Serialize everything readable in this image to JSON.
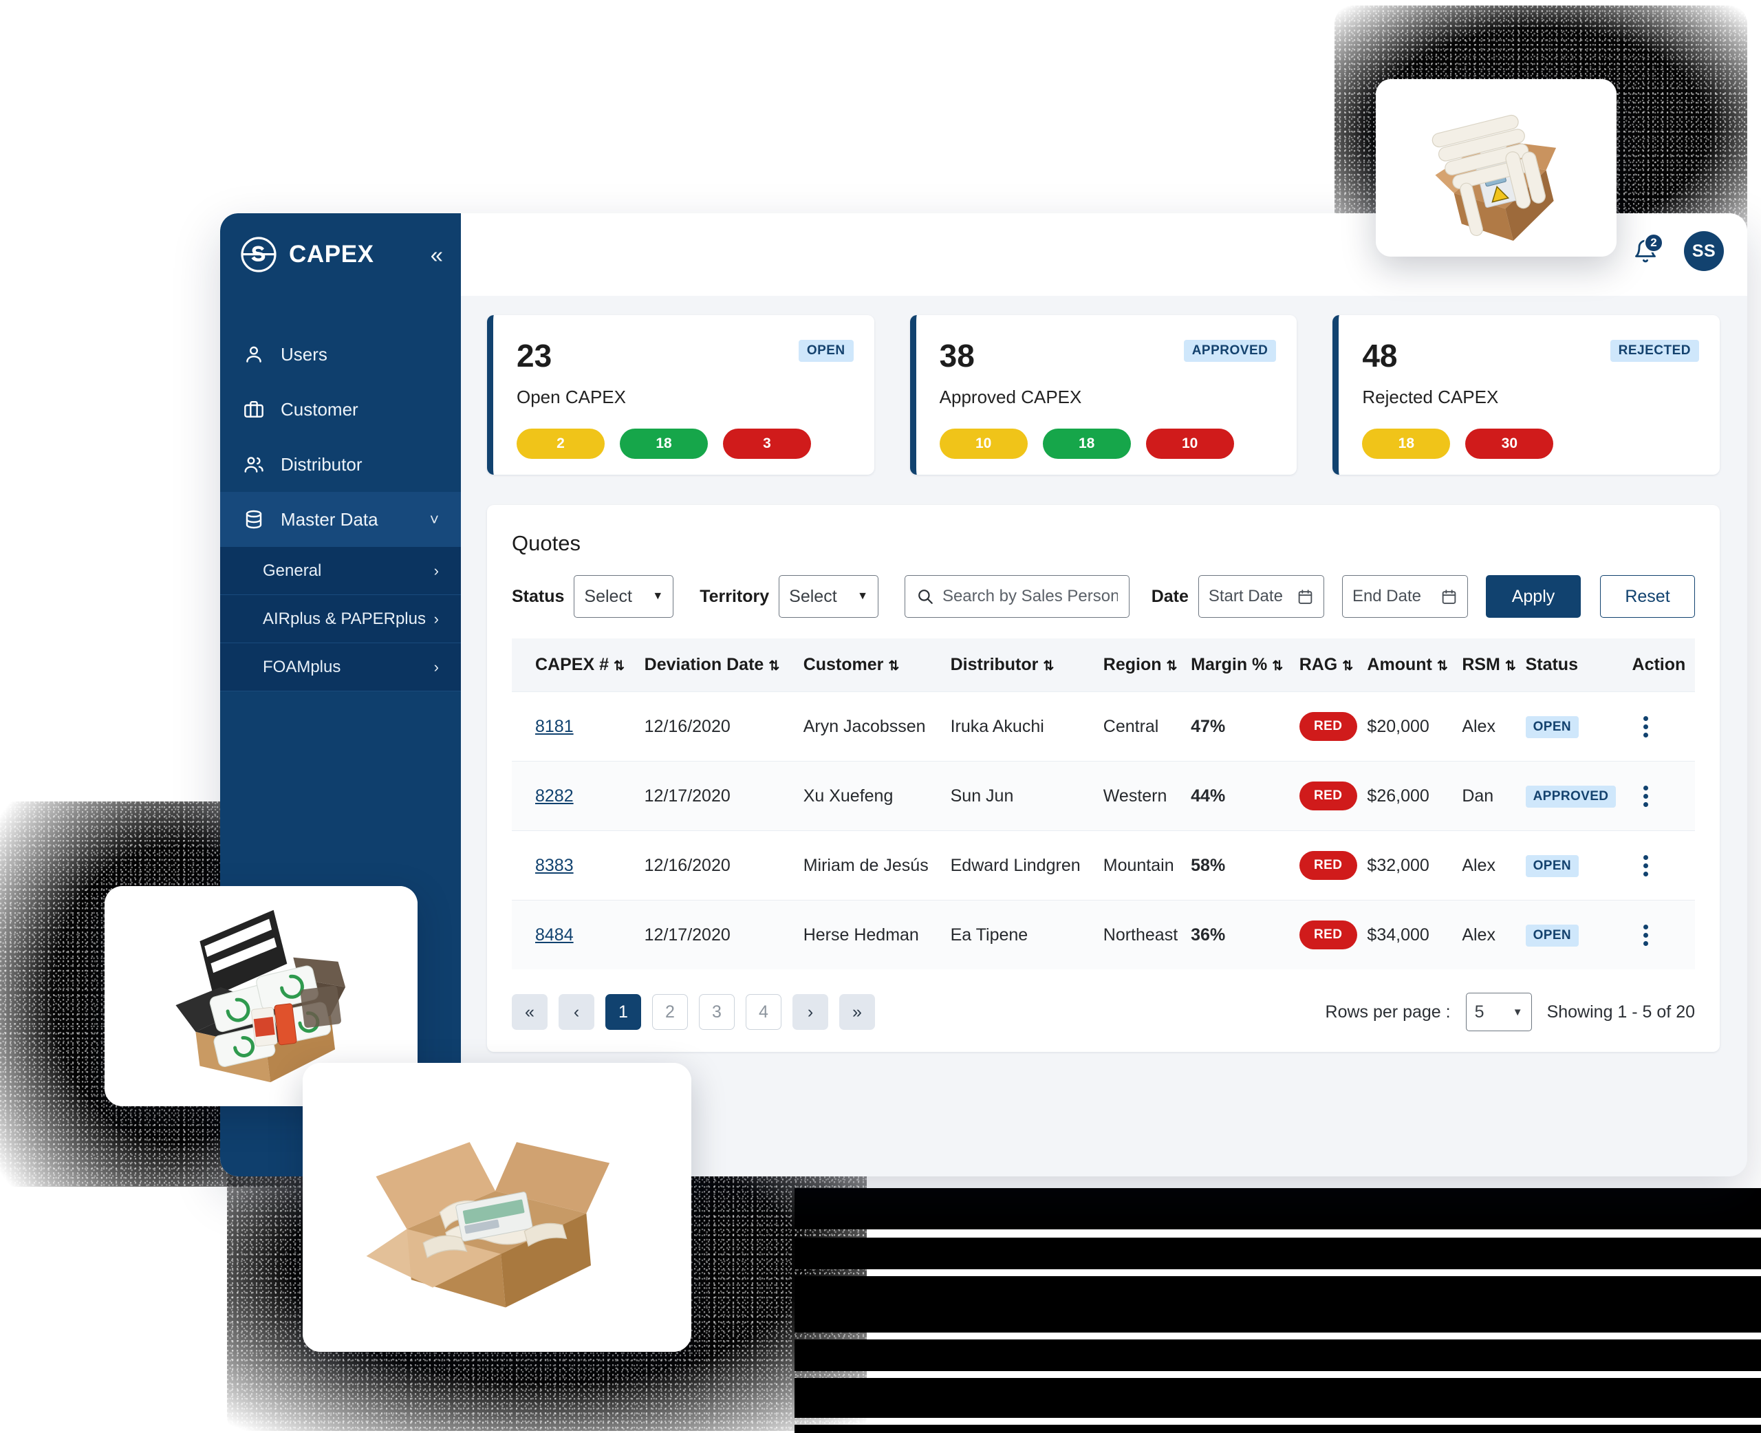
{
  "brand": {
    "title": "CAPEX",
    "logo_icon": "storopack-s-logo",
    "collapse_icon": "chevron-double-left-icon"
  },
  "header": {
    "notifications": {
      "icon": "bell-icon",
      "count": "2"
    },
    "avatar": {
      "initials": "SS"
    }
  },
  "sidebar": {
    "items": [
      {
        "label": "Users",
        "icon": "user-icon"
      },
      {
        "label": "Customer",
        "icon": "briefcase-icon"
      },
      {
        "label": "Distributor",
        "icon": "users-icon"
      },
      {
        "label": "Master Data",
        "icon": "database-icon",
        "expanded": true
      }
    ],
    "sub_items": [
      {
        "label": "General"
      },
      {
        "label": "AIRplus & PAPERplus"
      },
      {
        "label": "FOAMplus"
      }
    ]
  },
  "kpi_cards": [
    {
      "value": "23",
      "label": "Open CAPEX",
      "tag": "OPEN",
      "pills": [
        {
          "value": "2",
          "color": "amber"
        },
        {
          "value": "18",
          "color": "green"
        },
        {
          "value": "3",
          "color": "red"
        }
      ]
    },
    {
      "value": "38",
      "label": "Approved CAPEX",
      "tag": "APPROVED",
      "pills": [
        {
          "value": "10",
          "color": "amber"
        },
        {
          "value": "18",
          "color": "green"
        },
        {
          "value": "10",
          "color": "red"
        }
      ]
    },
    {
      "value": "48",
      "label": "Rejected CAPEX",
      "tag": "REJECTED",
      "pills": [
        {
          "value": "18",
          "color": "amber"
        },
        {
          "value": "30",
          "color": "red"
        }
      ]
    }
  ],
  "quotes": {
    "title": "Quotes",
    "filters": {
      "status_label": "Status",
      "status_value": "Select",
      "territory_label": "Territory",
      "territory_value": "Select",
      "search_placeholder": "Search by Sales Person",
      "search_value": "",
      "date_label": "Date",
      "start_date_placeholder": "Start Date",
      "end_date_placeholder": "End Date",
      "apply_label": "Apply",
      "reset_label": "Reset"
    },
    "columns": [
      {
        "label": "CAPEX #",
        "sortable": true
      },
      {
        "label": "Deviation Date",
        "sortable": true
      },
      {
        "label": "Customer",
        "sortable": true
      },
      {
        "label": "Distributor",
        "sortable": true
      },
      {
        "label": "Region",
        "sortable": true
      },
      {
        "label": "Margin %",
        "sortable": true
      },
      {
        "label": "RAG",
        "sortable": true
      },
      {
        "label": "Amount",
        "sortable": true
      },
      {
        "label": "RSM",
        "sortable": true
      },
      {
        "label": "Status",
        "sortable": false
      },
      {
        "label": "Action",
        "sortable": false
      }
    ],
    "rows": [
      {
        "capex": "8181",
        "deviation_date": "12/16/2020",
        "customer": "Aryn Jacobssen",
        "distributor": "Iruka Akuchi",
        "region": "Central",
        "margin": "47%",
        "rag": "RED",
        "amount": "$20,000",
        "rsm": "Alex",
        "status": "OPEN"
      },
      {
        "capex": "8282",
        "deviation_date": "12/17/2020",
        "customer": "Xu Xuefeng",
        "distributor": "Sun Jun",
        "region": "Western",
        "margin": "44%",
        "rag": "RED",
        "amount": "$26,000",
        "rsm": "Dan",
        "status": "APPROVED"
      },
      {
        "capex": "8383",
        "deviation_date": "12/16/2020",
        "customer": "Miriam de Jesús",
        "distributor": "Edward Lindgren",
        "region": "Mountain",
        "margin": "58%",
        "rag": "RED",
        "amount": "$32,000",
        "rsm": "Alex",
        "status": "OPEN"
      },
      {
        "capex": "8484",
        "deviation_date": "12/17/2020",
        "customer": "Herse Hedman",
        "distributor": "Ea Tipene",
        "region": "Northeast",
        "margin": "36%",
        "rag": "RED",
        "amount": "$34,000",
        "rsm": "Alex",
        "status": "OPEN"
      }
    ],
    "pagination": {
      "first_icon": "double-chevron-left-icon",
      "prev_icon": "chevron-left-icon",
      "pages": [
        "1",
        "2",
        "3",
        "4"
      ],
      "active_page": "1",
      "next_icon": "chevron-right-icon",
      "last_icon": "double-chevron-right-icon",
      "rows_per_page_label": "Rows per page :",
      "rows_per_page_value": "5",
      "showing_text": "Showing 1 - 5 of 20"
    }
  },
  "photos": [
    {
      "name": "airplus-cushions-in-box-photo"
    },
    {
      "name": "airplus-bio-grocery-box-photo"
    },
    {
      "name": "paperplus-open-carton-photo"
    }
  ],
  "colors": {
    "brand_navy": "#0f3f6d",
    "accent_blue": "#11426f",
    "badge_blue_bg": "#cfe7fb",
    "amber": "#f0c419",
    "green": "#16a64a",
    "red": "#d01b1b",
    "page_bg": "#f3f5f8"
  }
}
